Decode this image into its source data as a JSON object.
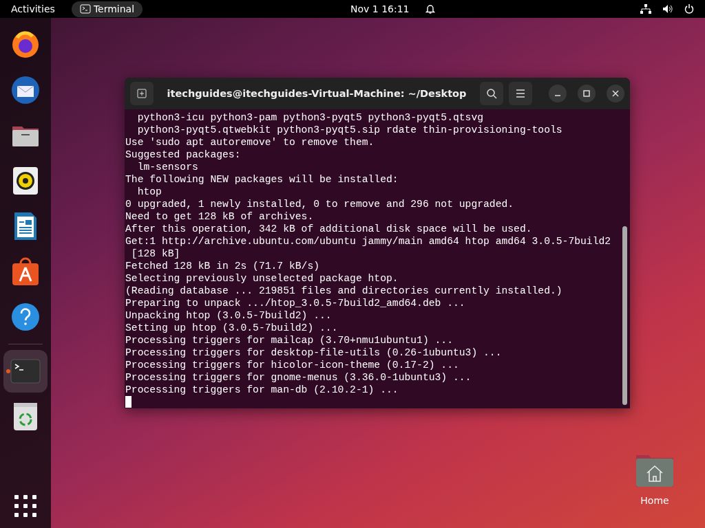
{
  "top_bar": {
    "activities": "Activities",
    "app_menu": "Terminal",
    "clock": "Nov 1  16:11"
  },
  "dock": [
    {
      "kind": "firefox",
      "running": false,
      "selected": false
    },
    {
      "kind": "thunderbird",
      "running": false,
      "selected": false
    },
    {
      "kind": "files",
      "running": false,
      "selected": false
    },
    {
      "kind": "rhythmbox",
      "running": false,
      "selected": false
    },
    {
      "kind": "writer",
      "running": false,
      "selected": false
    },
    {
      "kind": "software",
      "running": false,
      "selected": false
    },
    {
      "kind": "help",
      "running": false,
      "selected": false
    },
    {
      "kind": "terminal",
      "running": true,
      "selected": true
    },
    {
      "kind": "trash",
      "running": false,
      "selected": false
    }
  ],
  "window": {
    "title": "itechguides@itechguides-Virtual-Machine: ~/Desktop",
    "lines": [
      "  python3-icu python3-pam python3-pyqt5 python3-pyqt5.qtsvg",
      "  python3-pyqt5.qtwebkit python3-pyqt5.sip rdate thin-provisioning-tools",
      "Use 'sudo apt autoremove' to remove them.",
      "Suggested packages:",
      "  lm-sensors",
      "The following NEW packages will be installed:",
      "  htop",
      "0 upgraded, 1 newly installed, 0 to remove and 296 not upgraded.",
      "Need to get 128 kB of archives.",
      "After this operation, 342 kB of additional disk space will be used.",
      "Get:1 http://archive.ubuntu.com/ubuntu jammy/main amd64 htop amd64 3.0.5-7build2",
      " [128 kB]",
      "Fetched 128 kB in 2s (71.7 kB/s)",
      "Selecting previously unselected package htop.",
      "(Reading database ... 219851 files and directories currently installed.)",
      "Preparing to unpack .../htop_3.0.5-7build2_amd64.deb ...",
      "Unpacking htop (3.0.5-7build2) ...",
      "Setting up htop (3.0.5-7build2) ...",
      "Processing triggers for mailcap (3.70+nmu1ubuntu1) ...",
      "Processing triggers for desktop-file-utils (0.26-1ubuntu3) ...",
      "Processing triggers for hicolor-icon-theme (0.17-2) ...",
      "Processing triggers for gnome-menus (3.36.0-1ubuntu3) ...",
      "Processing triggers for man-db (2.10.2-1) ..."
    ]
  },
  "desktop_icons": [
    {
      "label": "Home"
    }
  ]
}
